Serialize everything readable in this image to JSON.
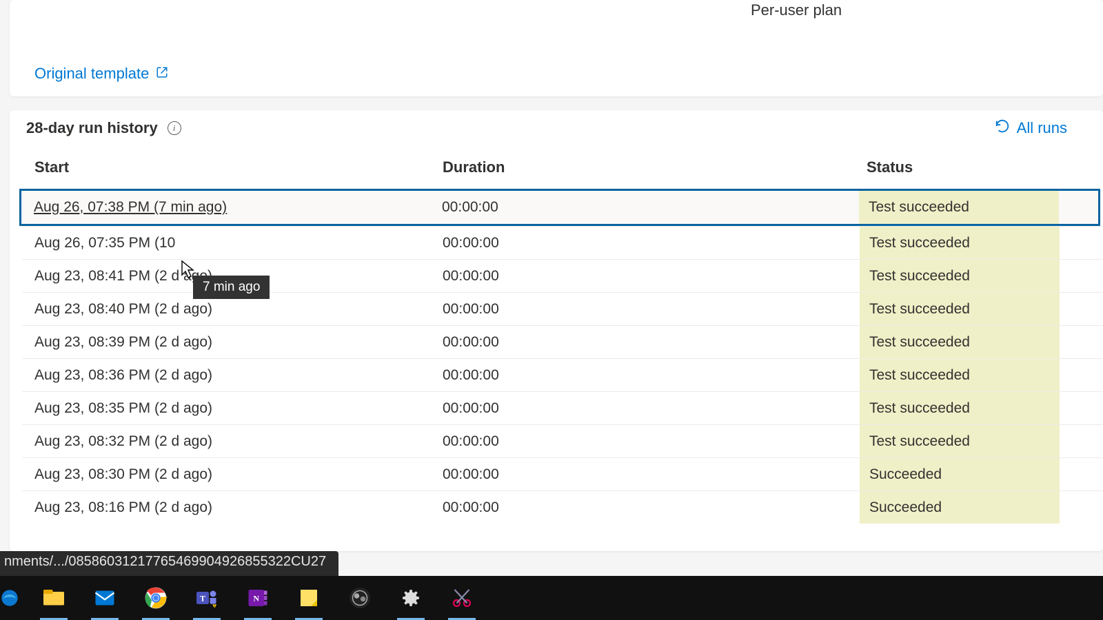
{
  "top": {
    "per_user_label": "Per-user plan",
    "original_template_label": "Original template"
  },
  "history": {
    "title": "28-day run history",
    "all_runs_label": "All runs",
    "columns": {
      "start": "Start",
      "duration": "Duration",
      "status": "Status"
    },
    "tooltip": "7 min ago",
    "rows": [
      {
        "start": "Aug 26, 07:38 PM (7 min ago)",
        "duration": "00:00:00",
        "status": "Test succeeded",
        "selected": true
      },
      {
        "start": "Aug 26, 07:35 PM (10",
        "duration": "00:00:00",
        "status": "Test succeeded"
      },
      {
        "start": "Aug 23, 08:41 PM (2 d ago)",
        "duration": "00:00:00",
        "status": "Test succeeded"
      },
      {
        "start": "Aug 23, 08:40 PM (2 d ago)",
        "duration": "00:00:00",
        "status": "Test succeeded"
      },
      {
        "start": "Aug 23, 08:39 PM (2 d ago)",
        "duration": "00:00:00",
        "status": "Test succeeded"
      },
      {
        "start": "Aug 23, 08:36 PM (2 d ago)",
        "duration": "00:00:00",
        "status": "Test succeeded"
      },
      {
        "start": "Aug 23, 08:35 PM (2 d ago)",
        "duration": "00:00:00",
        "status": "Test succeeded"
      },
      {
        "start": "Aug 23, 08:32 PM (2 d ago)",
        "duration": "00:00:00",
        "status": "Test succeeded"
      },
      {
        "start": "Aug 23, 08:30 PM (2 d ago)",
        "duration": "00:00:00",
        "status": "Succeeded"
      },
      {
        "start": "Aug 23, 08:16 PM (2 d ago)",
        "duration": "00:00:00",
        "status": "Succeeded"
      }
    ]
  },
  "status_bar": "nments/.../08586031217765469904926855322CU27",
  "taskbar_icons": [
    "edge",
    "file-explorer",
    "mail",
    "chrome",
    "teams",
    "onenote",
    "sticky-notes",
    "obs",
    "settings",
    "snip"
  ]
}
